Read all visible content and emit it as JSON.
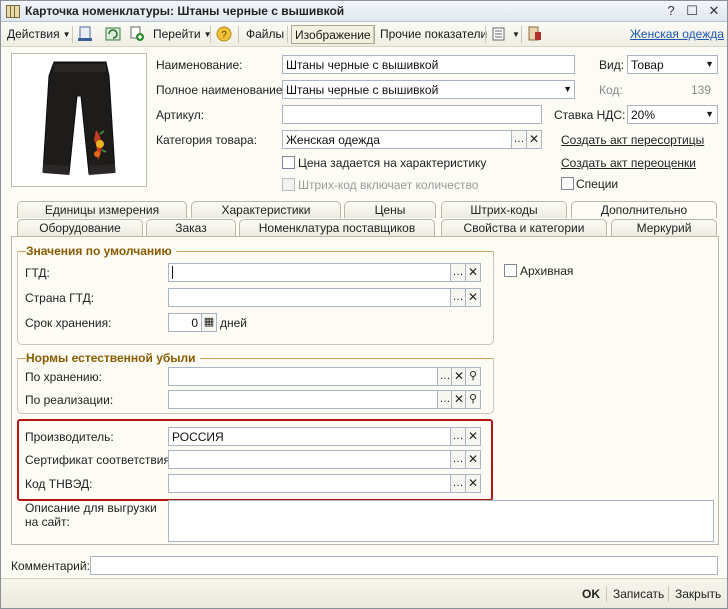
{
  "window": {
    "title": "Карточка номенклатуры: Штаны черные с вышивкой"
  },
  "toolbar": {
    "actions": "Действия",
    "navigate": "Перейти",
    "files": "Файлы",
    "image": "Изображение",
    "other_indicators": "Прочие показатели",
    "category_link": "Женская одежда"
  },
  "header": {
    "name_label": "Наименование:",
    "name_value": "Штаны черные с вышивкой",
    "full_name_label": "Полное наименование:",
    "full_name_value": "Штаны черные с вышивкой",
    "article_label": "Артикул:",
    "article_value": "",
    "category_label": "Категория товара:",
    "category_value": "Женская одежда",
    "price_by_char_label": "Цена задается на характеристику",
    "barcode_qty_label": "Штрих-код включает количество",
    "kind_label": "Вид:",
    "kind_value": "Товар",
    "code_label": "Код:",
    "code_value": "139",
    "vat_label": "Ставка НДС:",
    "vat_value": "20%",
    "create_regrade_link": "Создать акт пересортицы",
    "create_revaluation_link": "Создать акт переоценки",
    "spices_label": "Специи"
  },
  "tabs_row1": [
    "Единицы измерения",
    "Характеристики",
    "Цены",
    "Штрих-коды",
    "Дополнительно"
  ],
  "tabs_row2": [
    "Оборудование",
    "Заказ",
    "Номенклатура поставщиков",
    "Свойства и категории",
    "Меркурий"
  ],
  "defaults_group": {
    "title": "Значения по умолчанию",
    "gtd_label": "ГТД:",
    "gtd_value": "",
    "country_label": "Страна ГТД:",
    "country_value": "",
    "shelf_life_label": "Срок хранения:",
    "shelf_life_value": "0",
    "shelf_life_unit": "дней"
  },
  "archive_label": "Архивная",
  "loss_group": {
    "title": "Нормы естественной убыли",
    "storage_label": "По хранению:",
    "sale_label": "По реализации:"
  },
  "producer": {
    "manufacturer_label": "Производитель:",
    "manufacturer_value": "РОССИЯ",
    "certificate_label": "Сертификат соответствия:",
    "tnved_label": "Код ТНВЭД:"
  },
  "description_label": "Описание для выгрузки на сайт:",
  "comment_label": "Комментарий:",
  "bottom": {
    "ok": "OK",
    "save": "Записать",
    "close": "Закрыть"
  }
}
